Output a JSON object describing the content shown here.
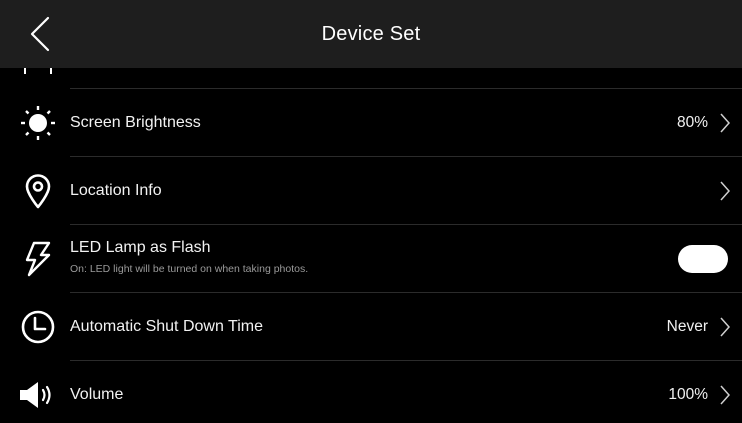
{
  "header": {
    "title": "Device Set",
    "back_icon": "chevron-left-icon"
  },
  "settings": [
    {
      "key": "brightness",
      "icon": "sun-icon",
      "label": "Screen Brightness",
      "value": "80%",
      "control": "chevron"
    },
    {
      "key": "location",
      "icon": "location-pin-icon",
      "label": "Location Info",
      "value": "",
      "control": "chevron"
    },
    {
      "key": "led_flash",
      "icon": "lightning-icon",
      "label": "LED Lamp as Flash",
      "sublabel": "On: LED light will be turned on when taking photos.",
      "control": "toggle",
      "toggle_on": true
    },
    {
      "key": "shutdown",
      "icon": "clock-icon",
      "label": "Automatic Shut Down Time",
      "value": "Never",
      "control": "chevron"
    },
    {
      "key": "volume",
      "icon": "speaker-icon",
      "label": "Volume",
      "value": "100%",
      "control": "chevron"
    }
  ],
  "colors": {
    "background": "#000000",
    "header": "#1e1e1e",
    "divider": "#2b2b2b",
    "text": "#ffffff",
    "subtext": "#9a9a9a"
  }
}
